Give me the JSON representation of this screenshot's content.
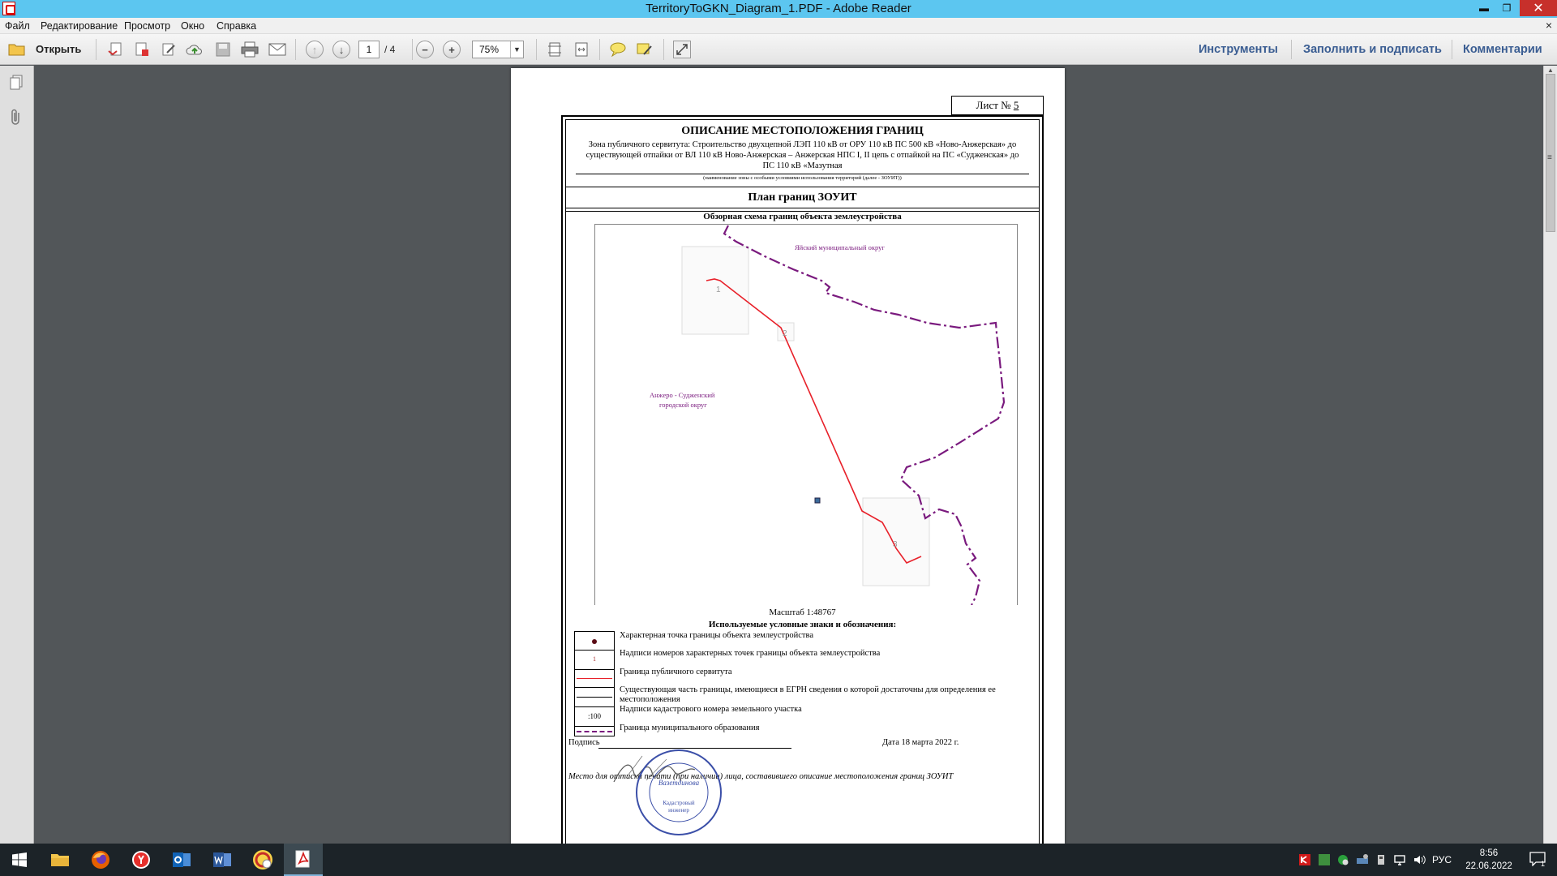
{
  "window": {
    "title": "TerritoryToGKN_Diagram_1.PDF - Adobe Reader",
    "minimize": "▬",
    "restore": "❐",
    "close": "✕"
  },
  "menu": {
    "items": [
      "Файл",
      "Редактирование",
      "Просмотр",
      "Окно",
      "Справка"
    ],
    "close": "×"
  },
  "toolbar": {
    "open_label": "Открыть",
    "page_current": "1",
    "page_total": "/ 4",
    "zoom": "75%",
    "panels": [
      "Инструменты",
      "Заполнить и подписать",
      "Комментарии"
    ]
  },
  "document": {
    "sheet_label": "Лист №",
    "sheet_number": "5",
    "title": "ОПИСАНИЕ МЕСТОПОЛОЖЕНИЯ ГРАНИЦ",
    "zone_description": "Зона публичного сервитута: Строительство двухцепной ЛЭП 110 кВ от ОРУ 110 кВ ПС 500 кВ «Ново-Анжерская» до существующей отпайки от ВЛ 110 кВ Ново-Анжерская – Анжерская НПС I, II цепь с отпайкой на ПС «Судженская» до ПС 110 кВ «Мазутная",
    "zone_caption": "(наименование зоны с особыми условиями использования территорий (далее - ЗОУИТ))",
    "plan_title": "План границ ЗОУИТ",
    "overview_title": "Обзорная схема границ объекта землеустройства",
    "map": {
      "label_north": "Яйский муниципальный округ",
      "label_west_1": "Анжеро - Судженский",
      "label_west_2": "городской округ",
      "point_1": "1",
      "point_2": "2",
      "point_3": "3"
    },
    "scale": "Масштаб 1:48767",
    "legend_title": "Используемые условные знаки и обозначения:",
    "legend": [
      "Характерная точка границы объекта землеустройства",
      "Надписи номеров характерных точек границы объекта землеустройства",
      "Граница публичного сервитута",
      "Существующая часть границы, имеющиеся в ЕГРН сведения о которой достаточны для определения ее местоположения",
      "Надписи кадастрового номера земельного участка",
      "Граница муниципального образования"
    ],
    "legend_symbols": {
      "point_number": "1",
      "cadastral": ":100"
    },
    "signature_label": "Подпись",
    "date": "Дата 18 марта 2022 г.",
    "stamp_note": "Место для оттиска печати (при наличии) лица, составившего описание местоположения границ ЗОУИТ",
    "stamp_text_1": "Вазетдинова",
    "stamp_text_2": "Кадастровый",
    "stamp_text_3": "инженер"
  },
  "colors": {
    "titlebar": "#5cc6f0",
    "panel_link": "#3a5d92",
    "servitude_line": "#e8212a",
    "municipal_border": "#7a1a7e",
    "map_label": "#7a1a7e",
    "stamp": "#3b4fa8"
  },
  "taskbar": {
    "lang": "РУС",
    "time": "8:56",
    "date": "22.06.2022",
    "notifications": "1"
  }
}
